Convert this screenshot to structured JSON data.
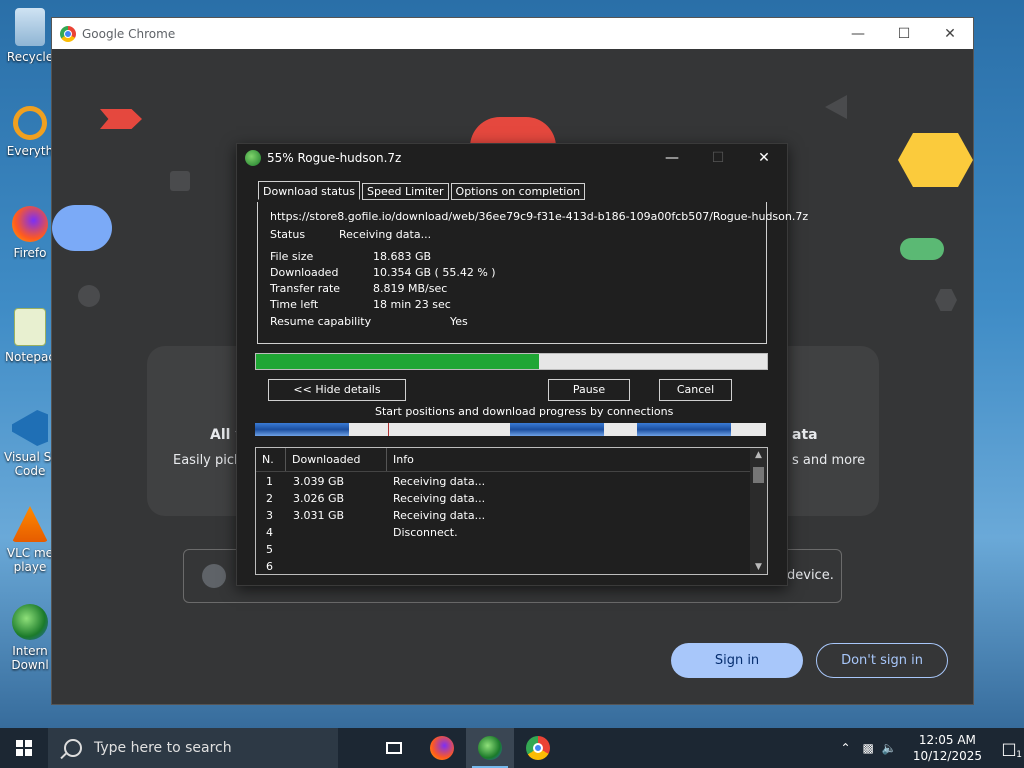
{
  "desktop": {
    "icons": [
      {
        "label": "Recycle",
        "icon": "recycle-bin-icon"
      },
      {
        "label": "Everyth",
        "icon": "everything-search-icon"
      },
      {
        "label": "Firefo",
        "icon": "firefox-icon"
      },
      {
        "label": "Notepac",
        "icon": "notepad-plus-icon"
      },
      {
        "label": "Visual St",
        "label2": "Code",
        "icon": "vscode-icon"
      },
      {
        "label": "VLC me",
        "label2": "playe",
        "icon": "vlc-icon"
      },
      {
        "label": "Intern",
        "label2": "Downl",
        "icon": "idm-icon"
      }
    ]
  },
  "chrome": {
    "title": "Google Chrome",
    "card_left_title": "All y",
    "card_left_sub": "Easily pick u",
    "card_right_title": "ata",
    "card_right_sub": "s and more",
    "row_text": "device.",
    "signin_label": "Sign in",
    "no_signin_label": "Don't sign in"
  },
  "idm": {
    "title": "55% Rogue-hudson.7z",
    "tabs": [
      "Download status",
      "Speed Limiter",
      "Options on completion"
    ],
    "url": "https://store8.gofile.io/download/web/36ee79c9-f31e-413d-b186-109a00fcb507/Rogue-hudson.7z",
    "status_label": "Status",
    "status_value": "Receiving data...",
    "file_size_label": "File size",
    "file_size_value": "18.683  GB",
    "downloaded_label": "Downloaded",
    "downloaded_value": "10.354  GB  ( 55.42 % )",
    "transfer_label": "Transfer rate",
    "transfer_value": "8.819  MB/sec",
    "time_left_label": "Time left",
    "time_left_value": "18 min 23 sec",
    "resume_label": "Resume capability",
    "resume_value": "Yes",
    "progress_fraction": 0.5542,
    "hide_details_label": "<< Hide details",
    "pause_label": "Pause",
    "cancel_label": "Cancel",
    "connections_caption": "Start positions and download progress by connections",
    "table": {
      "headers": [
        "N.",
        "Downloaded",
        "Info"
      ],
      "rows": [
        [
          "1",
          "3.039  GB",
          "Receiving data..."
        ],
        [
          "2",
          "3.026  GB",
          "Receiving data..."
        ],
        [
          "3",
          "3.031  GB",
          "Receiving data..."
        ],
        [
          "4",
          "",
          "Disconnect."
        ],
        [
          "5",
          "",
          ""
        ],
        [
          "6",
          "",
          ""
        ]
      ]
    }
  },
  "taskbar": {
    "search_placeholder": "Type here to search",
    "time": "12:05 AM",
    "date": "10/12/2025",
    "notification_count": "1"
  },
  "colors": {
    "progress_green": "#1fa634",
    "chrome_bg": "#353637",
    "signin_blue": "#a8c7fa"
  }
}
